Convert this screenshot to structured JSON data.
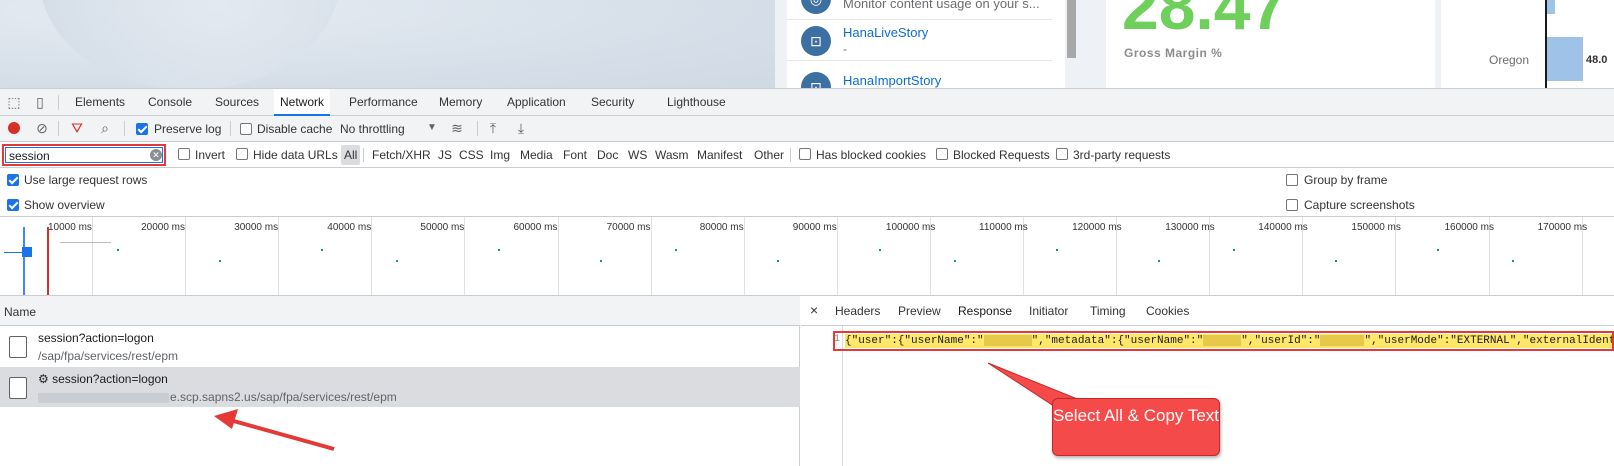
{
  "app": {
    "stories": [
      {
        "title": "Monitor content usage on your s...",
        "subtitle": ""
      },
      {
        "title": "HanaLiveStory",
        "subtitle": "-"
      },
      {
        "title": "HanaImportStory",
        "subtitle": ""
      }
    ],
    "kpi": {
      "value": "28.47",
      "label": "Gross Margin %"
    },
    "bar": {
      "label": "Oregon",
      "value": "48.0"
    }
  },
  "devtools": {
    "tabs": [
      "Elements",
      "Console",
      "Sources",
      "Network",
      "Performance",
      "Memory",
      "Application",
      "Security",
      "Lighthouse"
    ],
    "active_tab": "Network",
    "toolbar": {
      "preserve_log": "Preserve log",
      "disable_cache": "Disable cache",
      "throttling": "No throttling"
    },
    "filter": {
      "value": "session",
      "invert": "Invert",
      "hide_data_urls": "Hide data URLs",
      "types": [
        "All",
        "Fetch/XHR",
        "JS",
        "CSS",
        "Img",
        "Media",
        "Font",
        "Doc",
        "WS",
        "Wasm",
        "Manifest",
        "Other"
      ],
      "has_blocked_cookies": "Has blocked cookies",
      "blocked_requests": "Blocked Requests",
      "third_party": "3rd-party requests"
    },
    "settings": {
      "large_rows": "Use large request rows",
      "show_overview": "Show overview",
      "group_by_frame": "Group by frame",
      "capture_screenshots": "Capture screenshots"
    },
    "overview_ticks": [
      "10000 ms",
      "20000 ms",
      "30000 ms",
      "40000 ms",
      "50000 ms",
      "60000 ms",
      "70000 ms",
      "80000 ms",
      "90000 ms",
      "100000 ms",
      "110000 ms",
      "120000 ms",
      "130000 ms",
      "140000 ms",
      "150000 ms",
      "160000 ms",
      "170000 ms"
    ],
    "requests": {
      "column": "Name",
      "rows": [
        {
          "name": "session?action=logon",
          "path": "/sap/fpa/services/rest/epm"
        },
        {
          "name": "session?action=logon",
          "path": "e.scp.sapns2.us/sap/fpa/services/rest/epm"
        }
      ]
    },
    "detail": {
      "tabs": [
        "Headers",
        "Preview",
        "Response",
        "Initiator",
        "Timing",
        "Cookies"
      ],
      "active_tab": "Response",
      "line_number": "1",
      "code_parts": [
        "{\"user\":{\"userName\":\"",
        "\",\"metadata\":{\"userName\":\"",
        "\",\"userId\":\"",
        "\",\"userMode\":\"EXTERNAL\",\"externalIdentit"
      ]
    }
  },
  "annotation": {
    "text": "Select All & Copy Text",
    "color": "#f44a4a"
  }
}
